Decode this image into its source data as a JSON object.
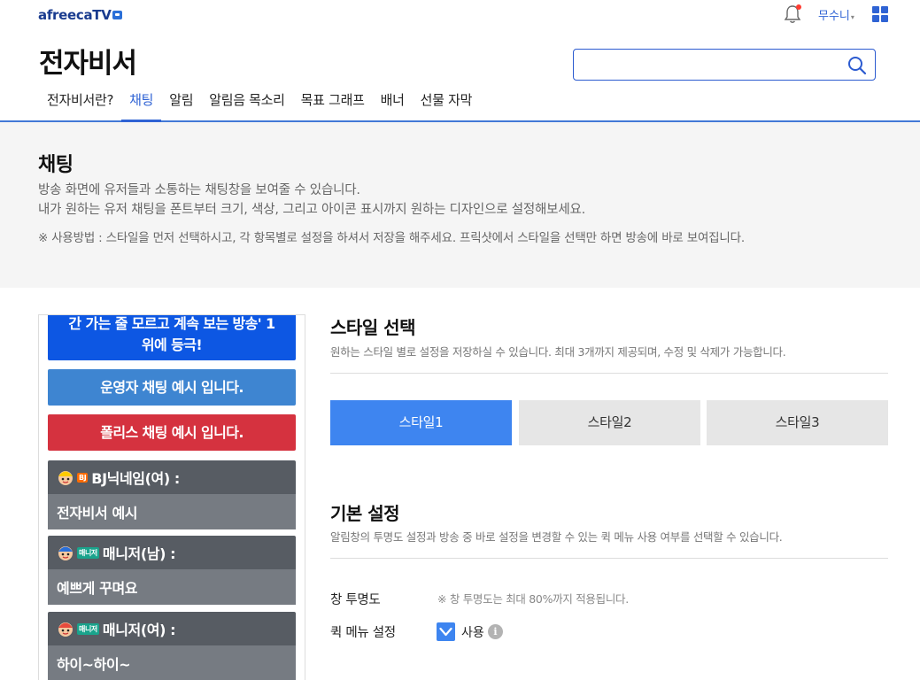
{
  "header": {
    "logo": "afreecaTV",
    "user_name": "무수니",
    "user_arrow": "▾",
    "page_title": "전자비서",
    "search_placeholder": ""
  },
  "tabs": [
    {
      "label": "전자비서란?",
      "active": false
    },
    {
      "label": "채팅",
      "active": true
    },
    {
      "label": "알림",
      "active": false
    },
    {
      "label": "알림음 목소리",
      "active": false
    },
    {
      "label": "목표 그래프",
      "active": false
    },
    {
      "label": "배너",
      "active": false
    },
    {
      "label": "선물 자막",
      "active": false
    }
  ],
  "info": {
    "title": "채팅",
    "desc_line1": "방송 화면에 유저들과 소통하는 채팅창을 보여줄 수 있습니다.",
    "desc_line2": "내가 원하는 유저 채팅을 폰트부터 크기, 색상, 그리고 아이콘 표시까지 원하는 디자인으로 설정해보세요.",
    "note": "※ 사용방법 : 스타일을 먼저 선택하시고, 각 항목별로 설정을 하셔서 저장을 해주세요. 프릭샷에서 스타일을 선택만 하면 방송에 바로 보여집니다."
  },
  "preview": {
    "blue_line1": "간 가는 줄 모르고 계속 보는 방송' 1",
    "blue_line2": "위에 등극!",
    "operator_msg": "운영자 채팅 예시 입니다.",
    "police_msg": "폴리스 채팅 예시 입니다.",
    "chats": [
      {
        "badge": "BJ",
        "badge_type": "bj",
        "name": "BJ닉네임(여) :",
        "message": "전자비서 예시"
      },
      {
        "badge": "매니저",
        "badge_type": "mgr",
        "name": "매니저(남) :",
        "message": "예쁘게 꾸며요"
      },
      {
        "badge": "매니저",
        "badge_type": "mgr",
        "name": "매니저(여) :",
        "message": "하이~하이~"
      }
    ]
  },
  "style_section": {
    "title": "스타일 선택",
    "desc": "원하는 스타일 별로 설정을 저장하실 수 있습니다. 최대 3개까지 제공되며, 수정 및 삭제가 가능합니다.",
    "buttons": [
      {
        "label": "스타일1",
        "active": true
      },
      {
        "label": "스타일2",
        "active": false
      },
      {
        "label": "스타일3",
        "active": false
      }
    ]
  },
  "basic_section": {
    "title": "기본 설정",
    "desc": "알림창의 투명도 설정과 방송 중 바로 설정을 변경할 수 있는 퀵 메뉴 사용 여부를 선택할 수 있습니다.",
    "opacity_label": "창 투명도",
    "opacity_note": "※ 창 투명도는 최대 80%까지 적용됩니다.",
    "quick_menu_label": "퀵 메뉴 설정",
    "quick_menu_checked": true,
    "quick_menu_use": "사용",
    "info_icon": "i"
  },
  "colors": {
    "accent": "#2f63d4",
    "style_active": "#3e85f0",
    "police": "#d5323f",
    "operator": "#3e85d1",
    "highlight": "#0d57e3"
  }
}
